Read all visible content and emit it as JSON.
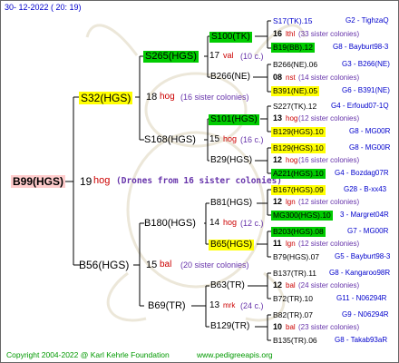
{
  "header": {
    "timestamp": "30- 12-2022 ( 20: 19)"
  },
  "footer": {
    "copyright": "Copyright 2004-2022 @ Karl Kehrle Foundation",
    "site": "www.pedigreeapis.org"
  },
  "root": {
    "label": "B99(HGS)",
    "gen_no": "19",
    "gen_word": "hog",
    "note": "(Drones from 16 sister colonies)"
  },
  "gen1": [
    {
      "label": "S32(HGS)",
      "num": "18",
      "word": "hog",
      "note": "(16 sister colonies)"
    },
    {
      "label": "B56(HGS)",
      "num": "15",
      "word": "bal",
      "note": "(20 sister colonies)"
    }
  ],
  "gen2": [
    {
      "label": "S265(HGS)",
      "num": "17",
      "word": "val",
      "note": "(10 c.)"
    },
    {
      "label": "S168(HGS)",
      "num": "15",
      "word": "hog",
      "note": "(16 c.)"
    },
    {
      "label": "B180(HGS)",
      "num": "14",
      "word": "hog",
      "note": "(12 c.)"
    },
    {
      "label": "B69(TR)",
      "num": "13",
      "word": "mrk",
      "note": "(24 c.)"
    }
  ],
  "gen3": [
    {
      "label": "S100(TK)"
    },
    {
      "label": "B266(NE)"
    },
    {
      "label": "S101(HGS)"
    },
    {
      "label": "B29(HGS)"
    },
    {
      "label": "B81(HGS)"
    },
    {
      "label": "B65(HGS)"
    },
    {
      "label": "B63(TR)"
    },
    {
      "label": "B129(TR)"
    }
  ],
  "gen4": [
    {
      "top": "S17(TK).15",
      "top_right": "G2 - TighzaQ",
      "num": "16",
      "word": "lthl",
      "note": "(33 sister colonies)",
      "bottom": "B19(BB).12",
      "bottom_right": "G8 - Bayburt98-3"
    },
    {
      "top": "B266(NE).06",
      "top_right": "G3 - B266(NE)",
      "num": "08",
      "word": "nst",
      "note": "(14 sister colonies)",
      "bottom": "B391(NE).05",
      "bottom_right": "G6 - B391(NE)"
    },
    {
      "top": "S227(TK).12",
      "top_right": "G4 - Erfoud07-1Q",
      "num": "13",
      "word": "hog",
      "note": "(12 sister colonies)",
      "bottom": "B129(HGS).10",
      "bottom_right": "G8 - MG00R"
    },
    {
      "top": "B129(HGS).10",
      "top_right": "G8 - MG00R",
      "num": "12",
      "word": "hog",
      "note": "(16 sister colonies)",
      "bottom": "A221(HGS).10",
      "bottom_right": "G4 - Bozdag07R"
    },
    {
      "top": "B167(HGS).09",
      "top_right": "G28 - B-xx43",
      "num": "12",
      "word": "lgn",
      "note": "(12 sister colonies)",
      "bottom": "MG300(HGS).10",
      "bottom_right": "3 - Margret04R"
    },
    {
      "top": "B203(HGS).08",
      "top_right": "G7 - MG00R",
      "num": "11",
      "word": "lgn",
      "note": "(12 sister colonies)",
      "bottom": "B79(HGS).07",
      "bottom_right": "G5 - Bayburt98-3"
    },
    {
      "top": "B137(TR).11",
      "top_right": "G8 - Kangaroo98R",
      "num": "12",
      "word": "bal",
      "note": "(24 sister colonies)",
      "bottom": "B72(TR).10",
      "bottom_right": "G11 - N06294R"
    },
    {
      "top": "B82(TR).07",
      "top_right": "G9 - N06294R",
      "num": "10",
      "word": "bal",
      "note": "(23 sister colonies)",
      "bottom": "B135(TR).06",
      "bottom_right": "G8 - Takab93aR"
    }
  ],
  "colors": {
    "blue": "#0000cc",
    "red": "#cc0000",
    "purple": "#6633aa",
    "green_hl": "#00cc00",
    "yellow_hl": "#ffff00",
    "pink_hl": "#ffcccc",
    "footer_green": "#009900"
  }
}
